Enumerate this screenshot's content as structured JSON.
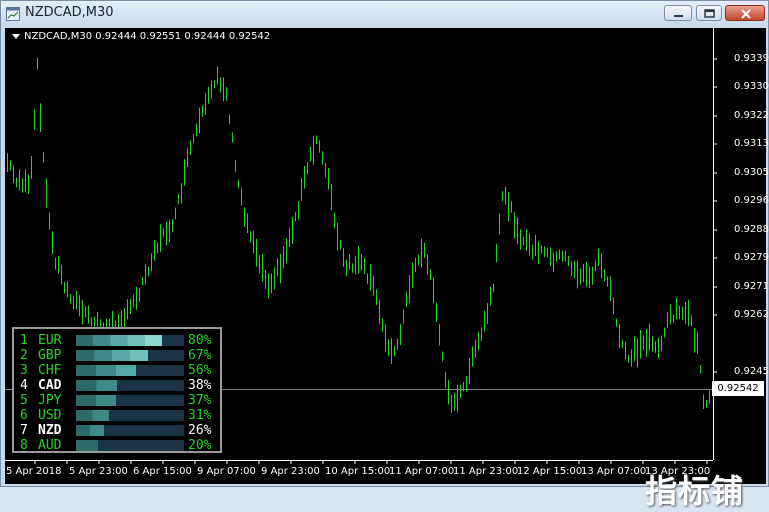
{
  "window": {
    "title": "NZDCAD,M30"
  },
  "chart": {
    "header": "NZDCAD,M30  0.92444 0.92551 0.92444 0.92542",
    "current_price": "0.92542",
    "bar_color": "#22d522",
    "price_line_color": "#808080",
    "price_labels": [
      "0.93390",
      "0.93305",
      "0.93220",
      "0.93135",
      "0.93050",
      "0.92965",
      "0.92880",
      "0.92795",
      "0.92710",
      "0.92625",
      "0.92455"
    ],
    "time_labels": [
      "5 Apr 2018",
      "5 Apr 23:00",
      "6 Apr 15:00",
      "9 Apr 07:00",
      "9 Apr 23:00",
      "10 Apr 15:00",
      "11 Apr 07:00",
      "11 Apr 23:00",
      "12 Apr 15:00",
      "13 Apr 07:00",
      "13 Apr 23:00"
    ]
  },
  "strength": {
    "rows": [
      {
        "rank": "1",
        "code": "EUR",
        "pct": "80%",
        "value": 0.8,
        "highlight": false
      },
      {
        "rank": "2",
        "code": "GBP",
        "pct": "67%",
        "value": 0.67,
        "highlight": false
      },
      {
        "rank": "3",
        "code": "CHF",
        "pct": "56%",
        "value": 0.56,
        "highlight": false
      },
      {
        "rank": "4",
        "code": "CAD",
        "pct": "38%",
        "value": 0.38,
        "highlight": true
      },
      {
        "rank": "5",
        "code": "JPY",
        "pct": "37%",
        "value": 0.37,
        "highlight": false
      },
      {
        "rank": "6",
        "code": "USD",
        "pct": "31%",
        "value": 0.31,
        "highlight": false
      },
      {
        "rank": "7",
        "code": "NZD",
        "pct": "26%",
        "value": 0.26,
        "highlight": true
      },
      {
        "rank": "8",
        "code": "AUD",
        "pct": "20%",
        "value": 0.2,
        "highlight": false
      }
    ],
    "colors": {
      "normal": "#22d522",
      "highlight": "#ffffff"
    }
  },
  "watermark": {
    "text": "指标铺"
  }
}
